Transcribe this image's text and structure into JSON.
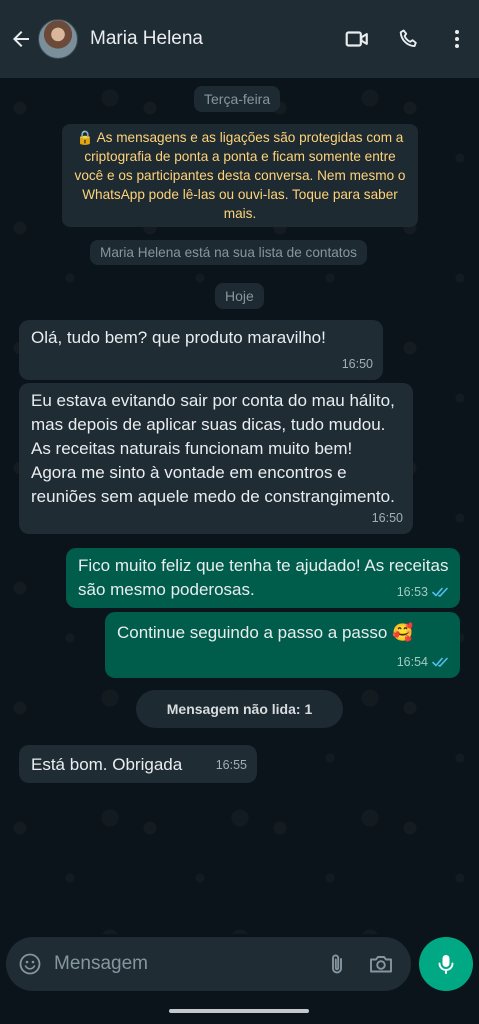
{
  "header": {
    "contact_name": "Maria Helena",
    "icons": [
      "back-arrow-icon",
      "video-call-icon",
      "phone-icon",
      "more-vert-icon"
    ]
  },
  "chat": {
    "day_label_1": "Terça-feira",
    "encryption_notice": "🔒 As mensagens e as ligações são protegidas com a criptografia de ponta a ponta e ficam somente entre você e os participantes desta conversa. Nem mesmo o WhatsApp pode lê-las ou ouvi-las. Toque para saber mais.",
    "contact_notice": "Maria Helena está na sua lista de contatos",
    "day_label_2": "Hoje",
    "messages": [
      {
        "direction": "in",
        "text": "Olá, tudo bem? que produto maravilho!",
        "time": "16:50"
      },
      {
        "direction": "in",
        "text": "Eu estava evitando sair por conta do mau hálito, mas depois de aplicar suas dicas, tudo mudou. As receitas naturais funcionam muito bem! Agora me sinto à vontade em encontros e reuniões sem aquele medo de constrangimento.",
        "time": "16:50"
      },
      {
        "direction": "out",
        "text": "Fico muito feliz que tenha te ajudado! As receitas são mesmo poderosas.",
        "time": "16:53",
        "status": "read"
      },
      {
        "direction": "out",
        "text": "Continue seguindo a passo a passo 🥰",
        "time": "16:54",
        "status": "read"
      },
      {
        "direction": "in",
        "text": "Está bom. Obrigada",
        "time": "16:55"
      }
    ],
    "unread_label": "Mensagem não lida: 1"
  },
  "composer": {
    "placeholder": "Mensagem",
    "icons": [
      "emoji-icon",
      "attach-icon",
      "camera-icon",
      "mic-icon"
    ]
  },
  "colors": {
    "background": "#0b141a",
    "header": "#1f2c34",
    "incoming_bubble": "#1f2c34",
    "outgoing_bubble": "#005c4b",
    "accent": "#00a884",
    "read_ticks": "#53bdeb",
    "encryption_text": "#ffd279"
  }
}
